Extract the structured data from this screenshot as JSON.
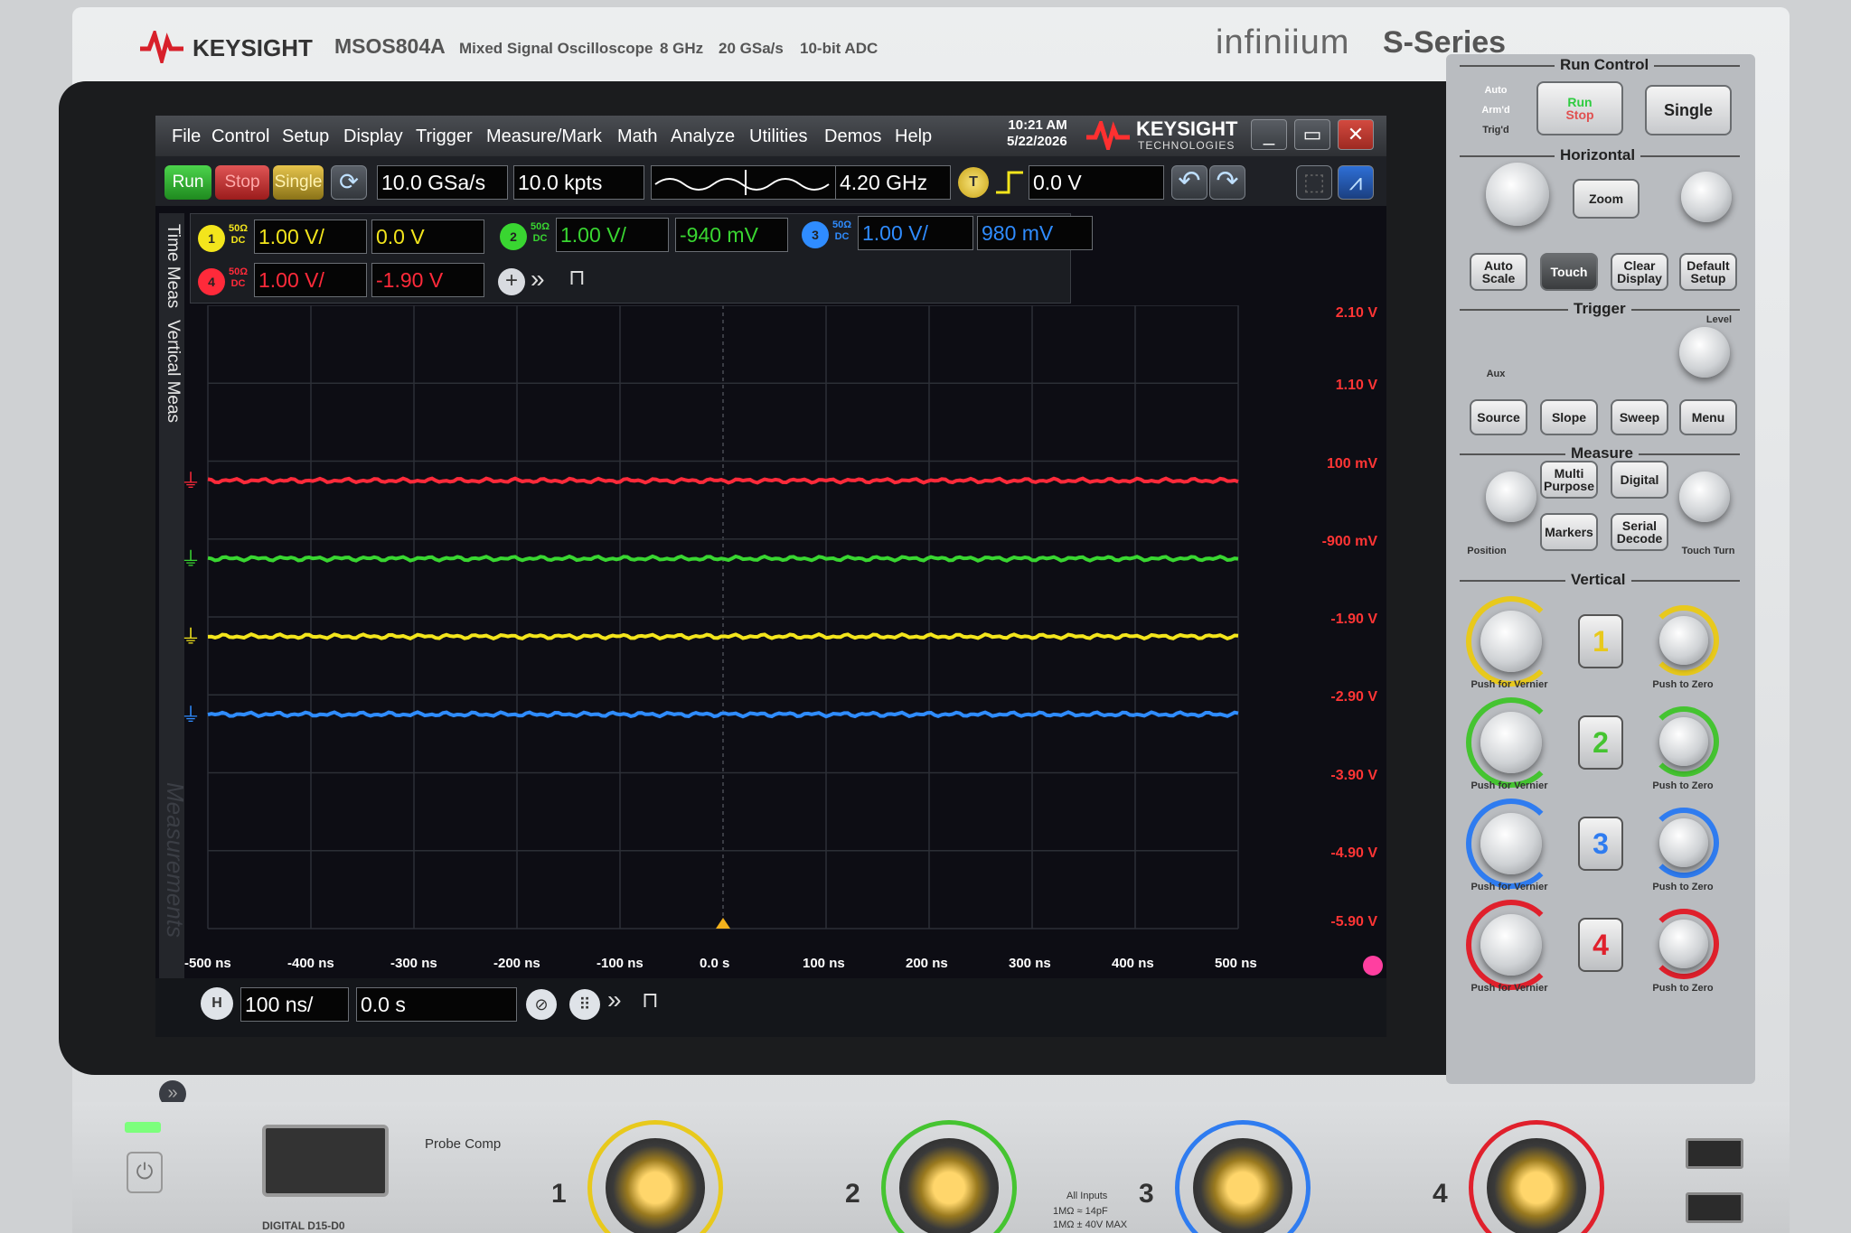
{
  "header": {
    "brand": "KEYSIGHT",
    "model": "MSOS804A",
    "description": "Mixed Signal Oscilloscope",
    "bandwidth": "8 GHz",
    "sample_rate": "20 GSa/s",
    "adc": "10-bit ADC",
    "family": "infiniium",
    "series": "S-Series"
  },
  "menubar": {
    "items": [
      "File",
      "Control",
      "Setup",
      "Display",
      "Trigger",
      "Measure/Mark",
      "Math",
      "Analyze",
      "Utilities",
      "Demos",
      "Help"
    ],
    "time": "10:21 AM",
    "date": "5/22/2026",
    "brand": "KEYSIGHT",
    "brand_sub": "TECHNOLOGIES",
    "minimize": "_",
    "restore": "▭",
    "close": "✕"
  },
  "toolbar": {
    "run": "Run",
    "stop": "Stop",
    "single": "Single",
    "sample_rate": "10.0 GSa/s",
    "memory_depth": "10.0 kpts",
    "bandwidth": "4.20 GHz",
    "trigger_badge": "T",
    "trigger_level": "0.0 V",
    "undo": "↶",
    "redo": "↷"
  },
  "side_tabs": {
    "time_meas": "Time Meas",
    "vertical_meas": "Vertical Meas",
    "measurements": "Measurements"
  },
  "channels": [
    {
      "num": "1",
      "coupling_top": "50Ω",
      "coupling_bottom": "DC",
      "scale": "1.00 V/",
      "offset": "0.0 V",
      "color": "#f3e51c"
    },
    {
      "num": "2",
      "coupling_top": "50Ω",
      "coupling_bottom": "DC",
      "scale": "1.00 V/",
      "offset": "-940 mV",
      "color": "#39d631"
    },
    {
      "num": "3",
      "coupling_top": "50Ω",
      "coupling_bottom": "DC",
      "scale": "1.00 V/",
      "offset": "980 mV",
      "color": "#2f8cff"
    },
    {
      "num": "4",
      "coupling_top": "50Ω",
      "coupling_bottom": "DC",
      "scale": "1.00 V/",
      "offset": "-1.90 V",
      "color": "#ff2a3a"
    }
  ],
  "waveform": {
    "right_scale": [
      "2.10 V",
      "1.10 V",
      "100 mV",
      "-900 mV",
      "-1.90 V",
      "-2.90 V",
      "-3.90 V",
      "-4.90 V",
      "-5.90 V"
    ],
    "time_axis": [
      "-500 ns",
      "-400 ns",
      "-300 ns",
      "-200 ns",
      "-100 ns",
      "0.0 s",
      "100 ns",
      "200 ns",
      "300 ns",
      "400 ns",
      "500 ns"
    ],
    "traces": [
      {
        "channel": "4",
        "level_divisions": 5.75,
        "color": "#ff2a3a"
      },
      {
        "channel": "2",
        "level_divisions": 4.75,
        "color": "#39d631"
      },
      {
        "channel": "1",
        "level_divisions": 3.75,
        "color": "#f3e51c"
      },
      {
        "channel": "3",
        "level_divisions": 2.75,
        "color": "#2f8cff"
      }
    ]
  },
  "horizontal_bar": {
    "badge": "H",
    "scale": "100 ns/",
    "position": "0.0 s"
  },
  "front_panel": {
    "run_control": "Run Control",
    "auto": "Auto",
    "armd": "Arm'd",
    "trigd": "Trig'd",
    "run": "Run",
    "stop": "Stop",
    "single": "Single",
    "horizontal": "Horizontal",
    "zoom": "Zoom",
    "auto_scale": "Auto Scale",
    "touch": "Touch",
    "clear_display": "Clear Display",
    "default_setup": "Default Setup",
    "trigger": "Trigger",
    "level": "Level",
    "aux": "Aux",
    "source": "Source",
    "slope": "Slope",
    "sweep": "Sweep",
    "menu": "Menu",
    "measure": "Measure",
    "multi_purpose": "Multi Purpose",
    "digital": "Digital",
    "markers": "Markers",
    "serial_decode": "Serial Decode",
    "position": "Position",
    "touch_turn": "Touch Turn",
    "vertical": "Vertical",
    "ch_buttons": [
      "1",
      "2",
      "3",
      "4"
    ],
    "push_vernier": "Push for Vernier",
    "push_zero": "Push to Zero"
  },
  "lower_panel": {
    "probe_comp": "Probe Comp",
    "digital_label": "DIGITAL D15-D0",
    "all_inputs": "All Inputs",
    "input_spec_1": "1MΩ ≈ 14pF",
    "input_spec_2": "1MΩ ± 40V MAX",
    "bnc_numbers": [
      "1",
      "2",
      "3",
      "4"
    ]
  }
}
